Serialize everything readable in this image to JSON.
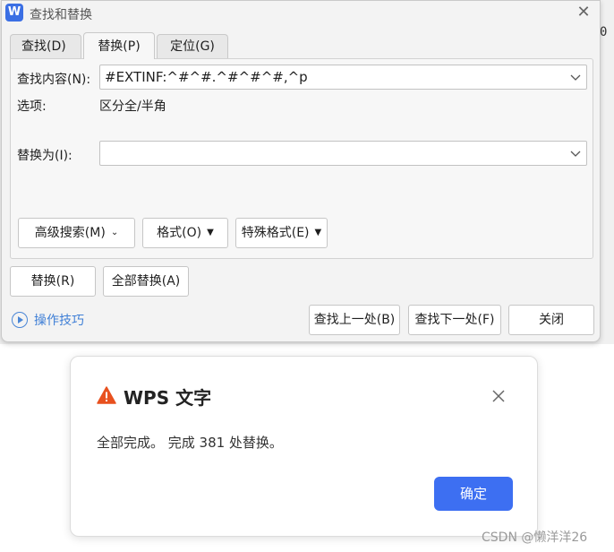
{
  "background": {
    "stray_char": "0",
    "watermark": "CSDN @懒洋洋26"
  },
  "dialog": {
    "icon_letter": "W",
    "title": "查找和替换",
    "tabs": [
      "查找(D)",
      "替换(P)",
      "定位(G)"
    ],
    "active_tab": 1,
    "find": {
      "label": "查找内容(N):",
      "value": "#EXTINF:^#^#.^#^#^#,^p"
    },
    "options": {
      "label": "选项:",
      "value": "区分全/半角"
    },
    "replace": {
      "label": "替换为(I):",
      "value": ""
    },
    "buttons": {
      "advanced_search": "高级搜索(M)",
      "format": "格式(O)",
      "special_format": "特殊格式(E)",
      "replace": "替换(R)",
      "replace_all": "全部替换(A)",
      "find_prev": "查找上一处(B)",
      "find_next": "查找下一处(F)",
      "close": "关闭"
    },
    "tips_link": "操作技巧",
    "colors": {
      "accent": "#3b6fe4",
      "link": "#3f7fd6"
    }
  },
  "message_box": {
    "title": "WPS 文字",
    "message": "全部完成。 完成 381 处替换。",
    "ok_label": "确定",
    "colors": {
      "primary": "#3d6ff2",
      "warning": "#e8511f"
    }
  }
}
